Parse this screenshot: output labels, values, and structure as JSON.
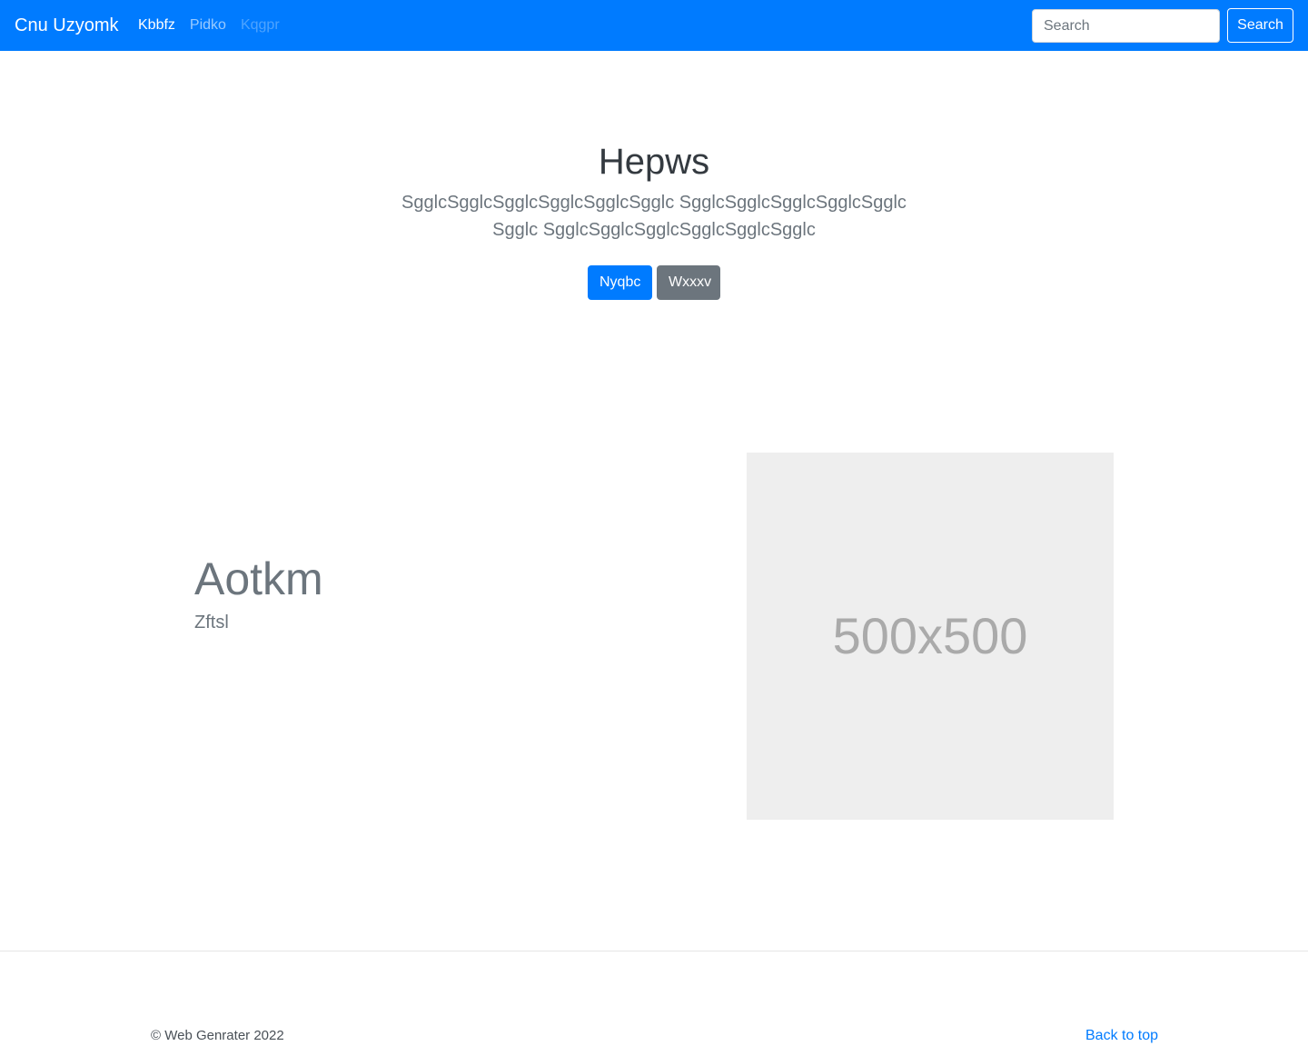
{
  "navbar": {
    "brand": "Cnu Uzyomk",
    "links": [
      {
        "label": "Kbbfz",
        "state": "active"
      },
      {
        "label": "Pidko",
        "state": "normal"
      },
      {
        "label": "Kqgpr",
        "state": "disabled"
      }
    ],
    "search_placeholder": "Search",
    "search_button": "Search",
    "background_color": "#007bff"
  },
  "hero": {
    "title": "Hepws",
    "lead": "SgglcSgglcSgglcSgglcSgglcSgglc SgglcSgglcSgglcSgglcSgglcSgglc SgglcSgglcSgglcSgglcSgglcSgglc",
    "primary_button": "Nyqbc",
    "secondary_button": "Wxxxv"
  },
  "feature": {
    "title": "Aotkm",
    "text": "Zftsl",
    "image_label": "500x500"
  },
  "footer": {
    "copyright": "© Web Genrater 2022",
    "back_to_top": "Back to top"
  }
}
